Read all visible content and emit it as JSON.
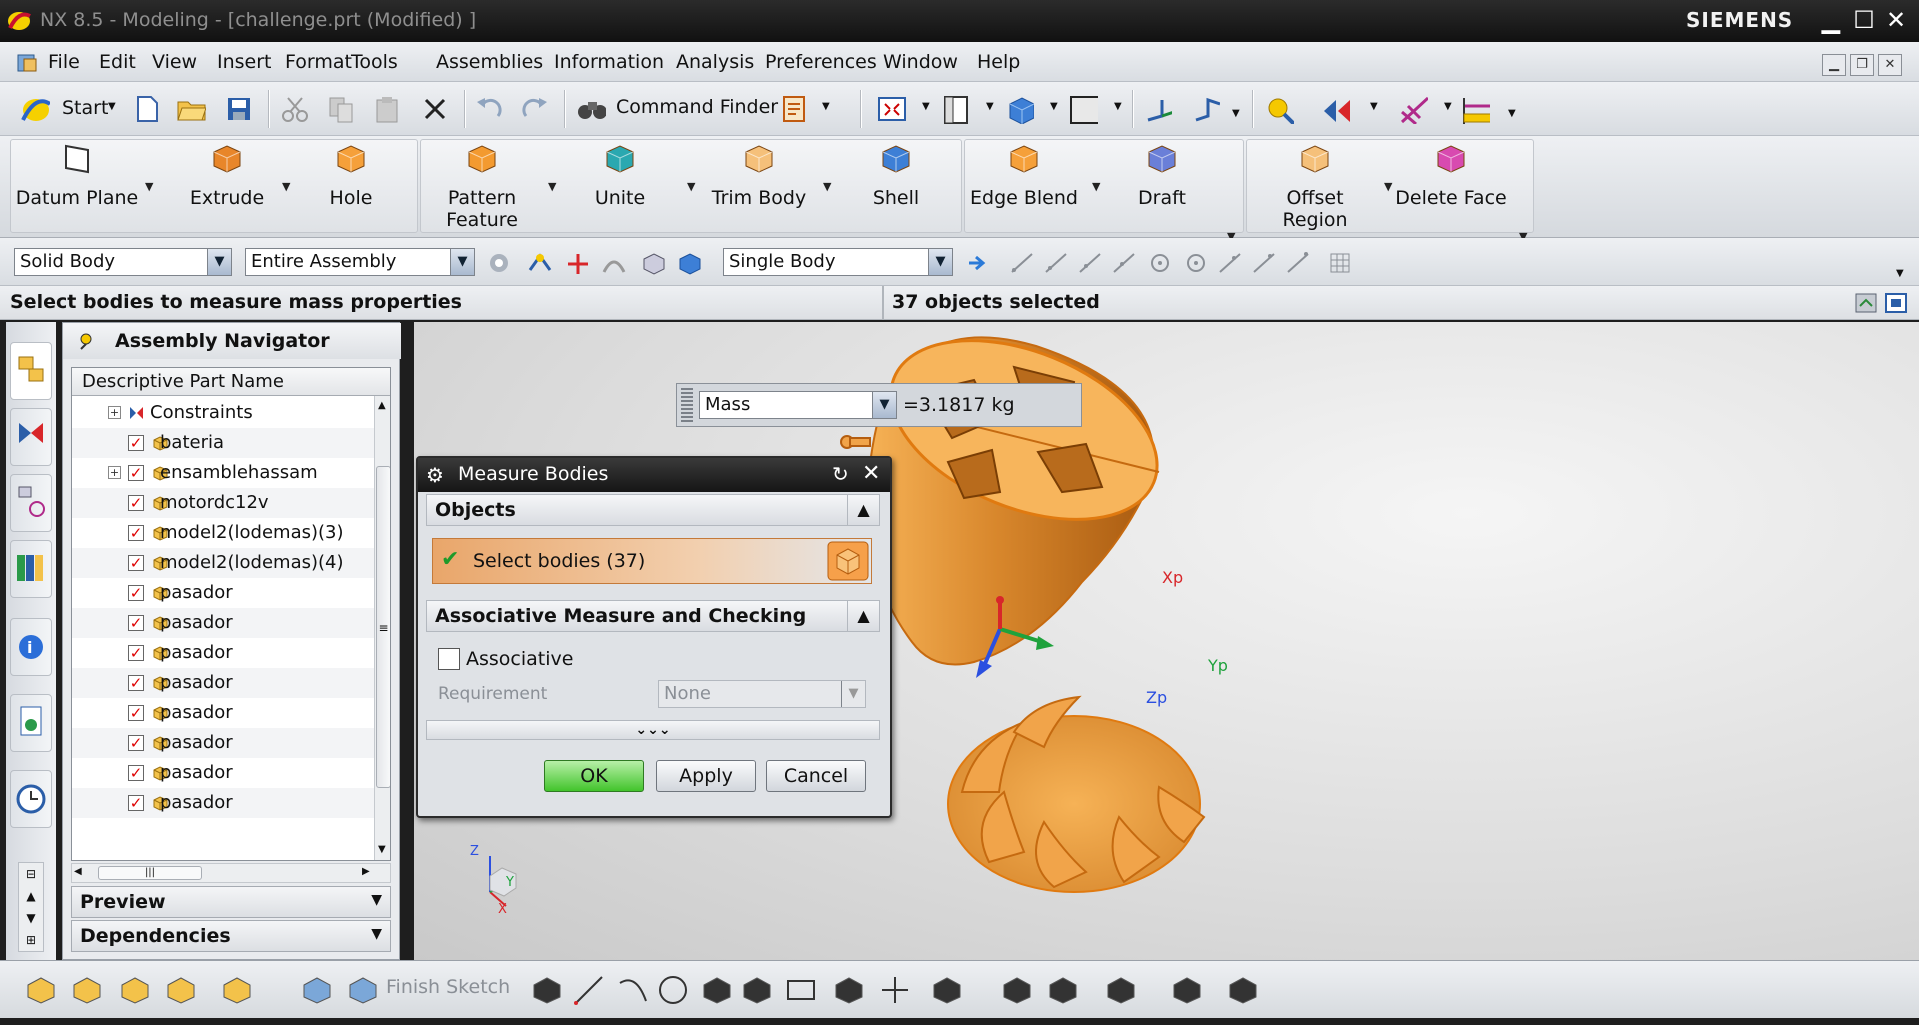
{
  "title_bar": {
    "title": "NX 8.5 - Modeling - [challenge.prt (Modified) ]",
    "brand": "SIEMENS"
  },
  "menu": [
    "File",
    "Edit",
    "View",
    "Insert",
    "Format",
    "Tools",
    "Assemblies",
    "Information",
    "Analysis",
    "Preferences",
    "Window",
    "Help"
  ],
  "standard_toolbar": {
    "start_label": "Start",
    "command_finder_label": "Command Finder"
  },
  "feature_toolbar": [
    {
      "label": "Datum Plane",
      "icon": "datum-plane-icon"
    },
    {
      "label": "Extrude",
      "icon": "extrude-icon"
    },
    {
      "label": "Hole",
      "icon": "hole-icon"
    },
    {
      "label": "Pattern Feature",
      "icon": "pattern-feature-icon"
    },
    {
      "label": "Unite",
      "icon": "unite-icon"
    },
    {
      "label": "Trim Body",
      "icon": "trim-body-icon"
    },
    {
      "label": "Shell",
      "icon": "shell-icon"
    },
    {
      "label": "Edge Blend",
      "icon": "edge-blend-icon"
    },
    {
      "label": "Draft",
      "icon": "draft-icon"
    },
    {
      "label": "Offset Region",
      "icon": "offset-region-icon"
    },
    {
      "label": "Delete Face",
      "icon": "delete-face-icon"
    }
  ],
  "selection_bar": {
    "type_filter": "Solid Body",
    "scope": "Entire Assembly",
    "body_rule": "Single Body"
  },
  "cue": {
    "message": "Select bodies to measure mass properties",
    "status": "37 objects selected"
  },
  "navigator": {
    "title": "Assembly Navigator",
    "column": "Descriptive Part Name",
    "rows": [
      {
        "name": "Constraints",
        "expandable": true,
        "checked": false
      },
      {
        "name": "bateria",
        "expandable": false,
        "checked": true
      },
      {
        "name": "ensamblehassam",
        "expandable": true,
        "checked": true
      },
      {
        "name": "motordc12v",
        "expandable": false,
        "checked": true
      },
      {
        "name": "model2(lodemas)(3)",
        "expandable": false,
        "checked": true
      },
      {
        "name": "model2(lodemas)(4)",
        "expandable": false,
        "checked": true
      },
      {
        "name": "pasador",
        "expandable": false,
        "checked": true
      },
      {
        "name": "pasador",
        "expandable": false,
        "checked": true
      },
      {
        "name": "pasador",
        "expandable": false,
        "checked": true
      },
      {
        "name": "pasador",
        "expandable": false,
        "checked": true
      },
      {
        "name": "pasador",
        "expandable": false,
        "checked": true
      },
      {
        "name": "pasador",
        "expandable": false,
        "checked": true
      },
      {
        "name": "pasador",
        "expandable": false,
        "checked": true
      },
      {
        "name": "pasador",
        "expandable": false,
        "checked": true
      }
    ],
    "preview_label": "Preview",
    "dependencies_label": "Dependencies"
  },
  "mass_readout": {
    "property": "Mass",
    "value": "=3.1817 kg"
  },
  "dialog": {
    "title": "Measure Bodies",
    "objects_header": "Objects",
    "select_label": "Select bodies (37)",
    "assoc_header": "Associative Measure and Checking",
    "associative_label": "Associative",
    "requirement_label": "Requirement",
    "requirement_value": "None",
    "ok": "OK",
    "apply": "Apply",
    "cancel": "Cancel"
  },
  "csys": {
    "x": "Xp",
    "y": "Yp",
    "z": "Zp"
  },
  "triad": {
    "x": "X",
    "y": "Y",
    "z": "Z"
  },
  "bottom_toolbar": {
    "finish_sketch": "Finish Sketch"
  },
  "colors": {
    "part_orange": "#f4a23c",
    "accent_select": "#e9b98a"
  }
}
